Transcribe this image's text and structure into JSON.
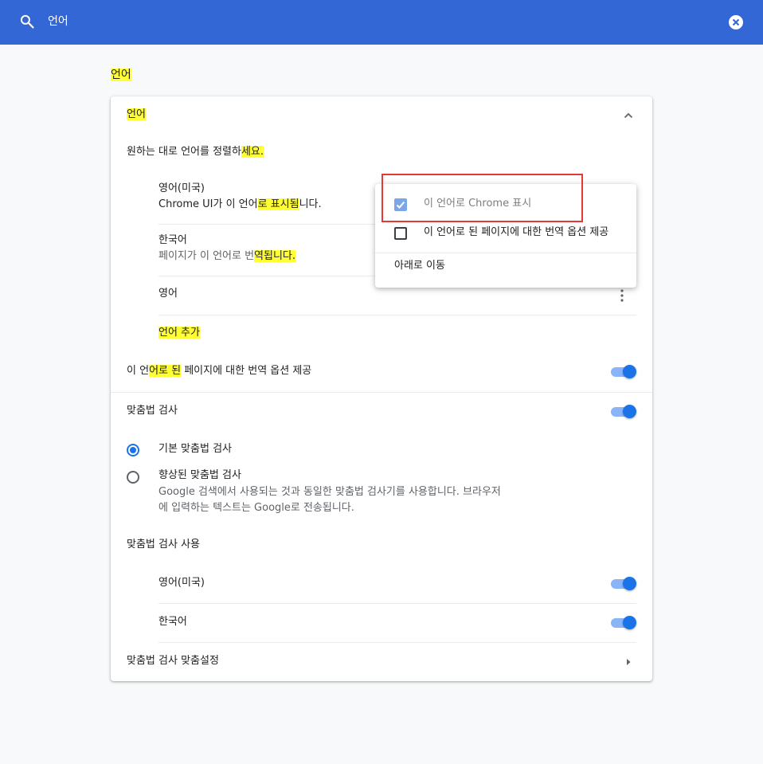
{
  "topbar": {
    "search_value": "언어",
    "bg_color": "#3367d6",
    "search_icon": "search-icon",
    "clear_icon": "close-circle-icon"
  },
  "page_heading": "언어",
  "languages_section": {
    "title": "언어",
    "intro_a": "원하는 대로 언어를 정렬하",
    "intro_b": "세요.",
    "items": [
      {
        "name": "영어(미국)",
        "note_a": "Chrome UI가 이 언어",
        "note_b": "로 표시됨",
        "note_c": "니다."
      },
      {
        "name": "한국어",
        "note_a": "페이지가 이 언어로 번",
        "note_b": "역됩니다.",
        "note_c": ""
      },
      {
        "name": "영어"
      }
    ],
    "add_language": "언어 추가",
    "offer_translate_a": "이 언",
    "offer_translate_b": "어로 된",
    "offer_translate_c": " 페이지에 대한 번역 옵션 제공",
    "offer_translate_enabled": true
  },
  "context_menu": {
    "display_in_language": "이 언어로 Chrome 표시",
    "display_in_language_checked": true,
    "offer_translate": "이 언어로 된 페이지에 대한 번역 옵션 제공",
    "offer_translate_checked": false,
    "move_down": "아래로 이동"
  },
  "spellcheck": {
    "title": "맞춤법 검사",
    "enabled": true,
    "basic_label": "기본 맞춤법 검사",
    "basic_selected": true,
    "enhanced_label": "향상된 맞춤법 검사",
    "enhanced_desc_1": "Google 검색에서 사용되는 것과 동일한 맞춤법 검사기를 사용합니다. 브라우저",
    "enhanced_desc_2": "에 입력하는 텍스트는 Google로 전송됩니다.",
    "use_for_title": "맞춤법 검사 사용",
    "languages": [
      {
        "name": "영어(미국)",
        "enabled": true
      },
      {
        "name": "한국어",
        "enabled": true
      }
    ],
    "customize": "맞춤법 검사 맞춤설정"
  },
  "colors": {
    "accent": "#1a73e8",
    "highlight": "#ffff33",
    "annotation_box": "#e53935"
  }
}
